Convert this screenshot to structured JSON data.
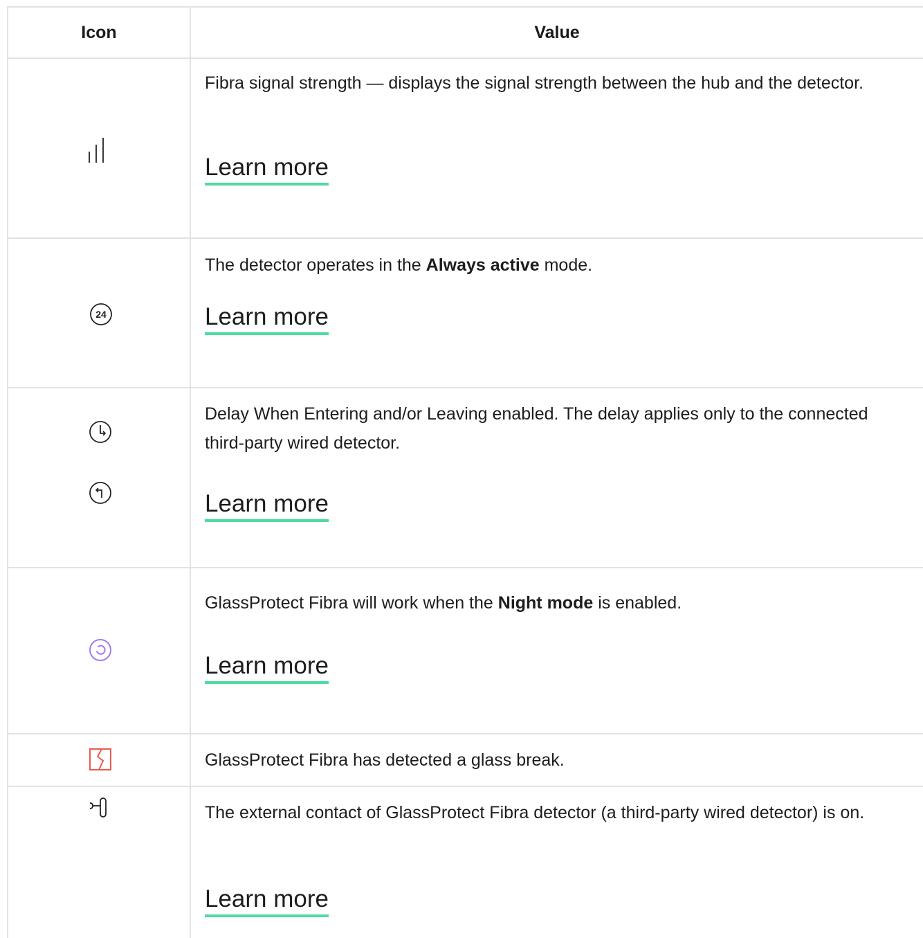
{
  "table": {
    "headers": {
      "icon": "Icon",
      "value": "Value"
    },
    "rows": [
      {
        "icons": [
          "signal-strength-icon"
        ],
        "description": "Fibra signal strength — displays the signal strength between the hub and the detector.",
        "link": "Learn more"
      },
      {
        "icons": [
          "always-active-24-icon"
        ],
        "icon_text": "24",
        "description_parts": [
          "The detector operates in the ",
          "Always active",
          " mode."
        ],
        "link": "Learn more"
      },
      {
        "icons": [
          "entry-delay-icon",
          "exit-delay-icon"
        ],
        "description": "Delay When Entering and/or Leaving enabled. The delay applies only to the connected third-party wired detector.",
        "link": "Learn more"
      },
      {
        "icons": [
          "night-mode-icon"
        ],
        "icon_color": "#a678f0",
        "description_parts": [
          "GlassProtect Fibra will work when the ",
          "Night mode",
          " is enabled."
        ],
        "link": "Learn more"
      },
      {
        "icons": [
          "glass-break-icon"
        ],
        "icon_color": "#ea5a4f",
        "description": "GlassProtect Fibra has detected a glass break."
      },
      {
        "icons": [
          "external-contact-icon"
        ],
        "description": "The external contact of GlassProtect Fibra detector (a third-party wired detector) is on.",
        "link": "Learn more"
      }
    ]
  },
  "colors": {
    "link_underline": "#4fdba0",
    "border": "#e2e2e2",
    "text": "#1d1d1d"
  }
}
